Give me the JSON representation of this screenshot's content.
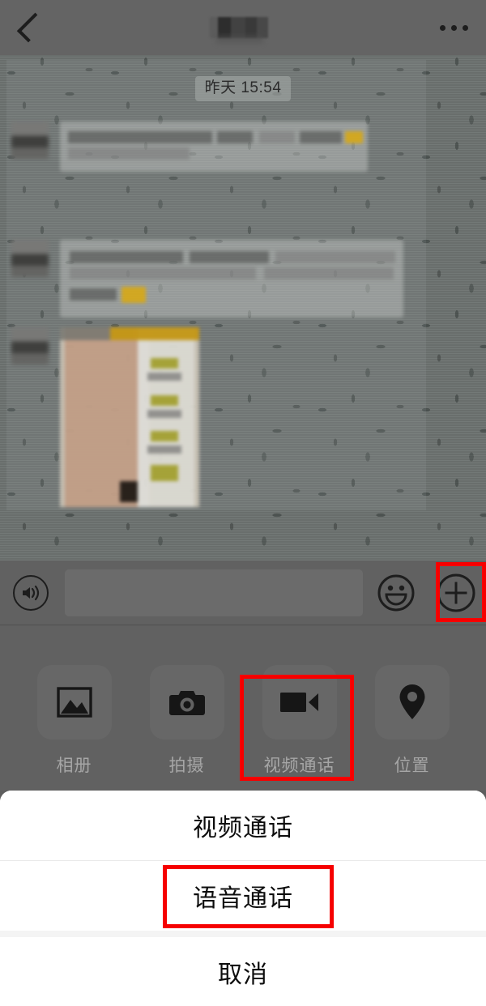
{
  "header": {
    "back_icon": "chevron-left-icon",
    "title": "",
    "title_censored": true,
    "more_icon": "more-horizontal-icon"
  },
  "chat": {
    "timestamp": "昨天 15:54",
    "messages": [
      {
        "type": "text",
        "censored": true,
        "sender": "other"
      },
      {
        "type": "text",
        "censored": true,
        "sender": "other"
      },
      {
        "type": "image",
        "censored": true,
        "sender": "other"
      }
    ]
  },
  "input_bar": {
    "voice_icon": "voice-wave-icon",
    "text_value": "",
    "text_placeholder": "",
    "emoji_icon": "smiley-icon",
    "plus_icon": "plus-circle-icon"
  },
  "attachments": {
    "items": [
      {
        "label": "相册",
        "icon": "photo-icon"
      },
      {
        "label": "拍摄",
        "icon": "camera-icon"
      },
      {
        "label": "视频通话",
        "icon": "video-camera-icon"
      },
      {
        "label": "位置",
        "icon": "location-pin-icon"
      }
    ],
    "highlighted_index": 2
  },
  "action_sheet": {
    "options": [
      {
        "label": "视频通话",
        "highlighted": false
      },
      {
        "label": "语音通话",
        "highlighted": true
      }
    ],
    "cancel_label": "取消"
  },
  "highlights": {
    "color": "#f60000",
    "targets": [
      "plus-button",
      "video-call-attachment",
      "voice-call-option"
    ]
  }
}
